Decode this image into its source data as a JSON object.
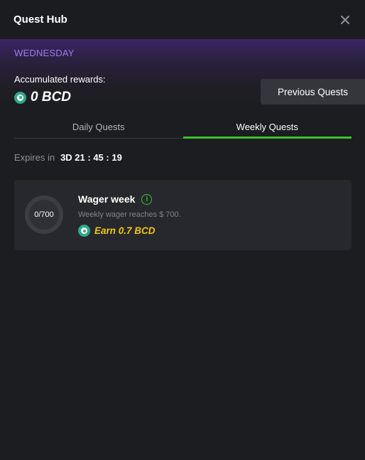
{
  "header": {
    "title": "Quest Hub",
    "close_icon": "close-icon"
  },
  "hero": {
    "day": "WEDNESDAY",
    "accumulated_label": "Accumulated rewards:",
    "accumulated_amount": "0 BCD",
    "coin_icon": "bcd-coin-icon",
    "previous_quests_label": "Previous Quests"
  },
  "tabs": [
    {
      "label": "Daily Quests",
      "active": false
    },
    {
      "label": "Weekly Quests",
      "active": true
    }
  ],
  "expires": {
    "label": "Expires in",
    "value": "3D 21 : 45 : 19"
  },
  "quests": [
    {
      "name": "Wager week",
      "progress_text": "0/700",
      "progress_fraction": 0,
      "description": "Weekly wager reaches $ 700.",
      "reward": "Earn 0.7 BCD"
    }
  ],
  "colors": {
    "accent_green": "#3fbf2f",
    "day_purple": "#9b7df0",
    "reward_gold": "#f5c518",
    "coin_teal": "#2ea98a"
  }
}
